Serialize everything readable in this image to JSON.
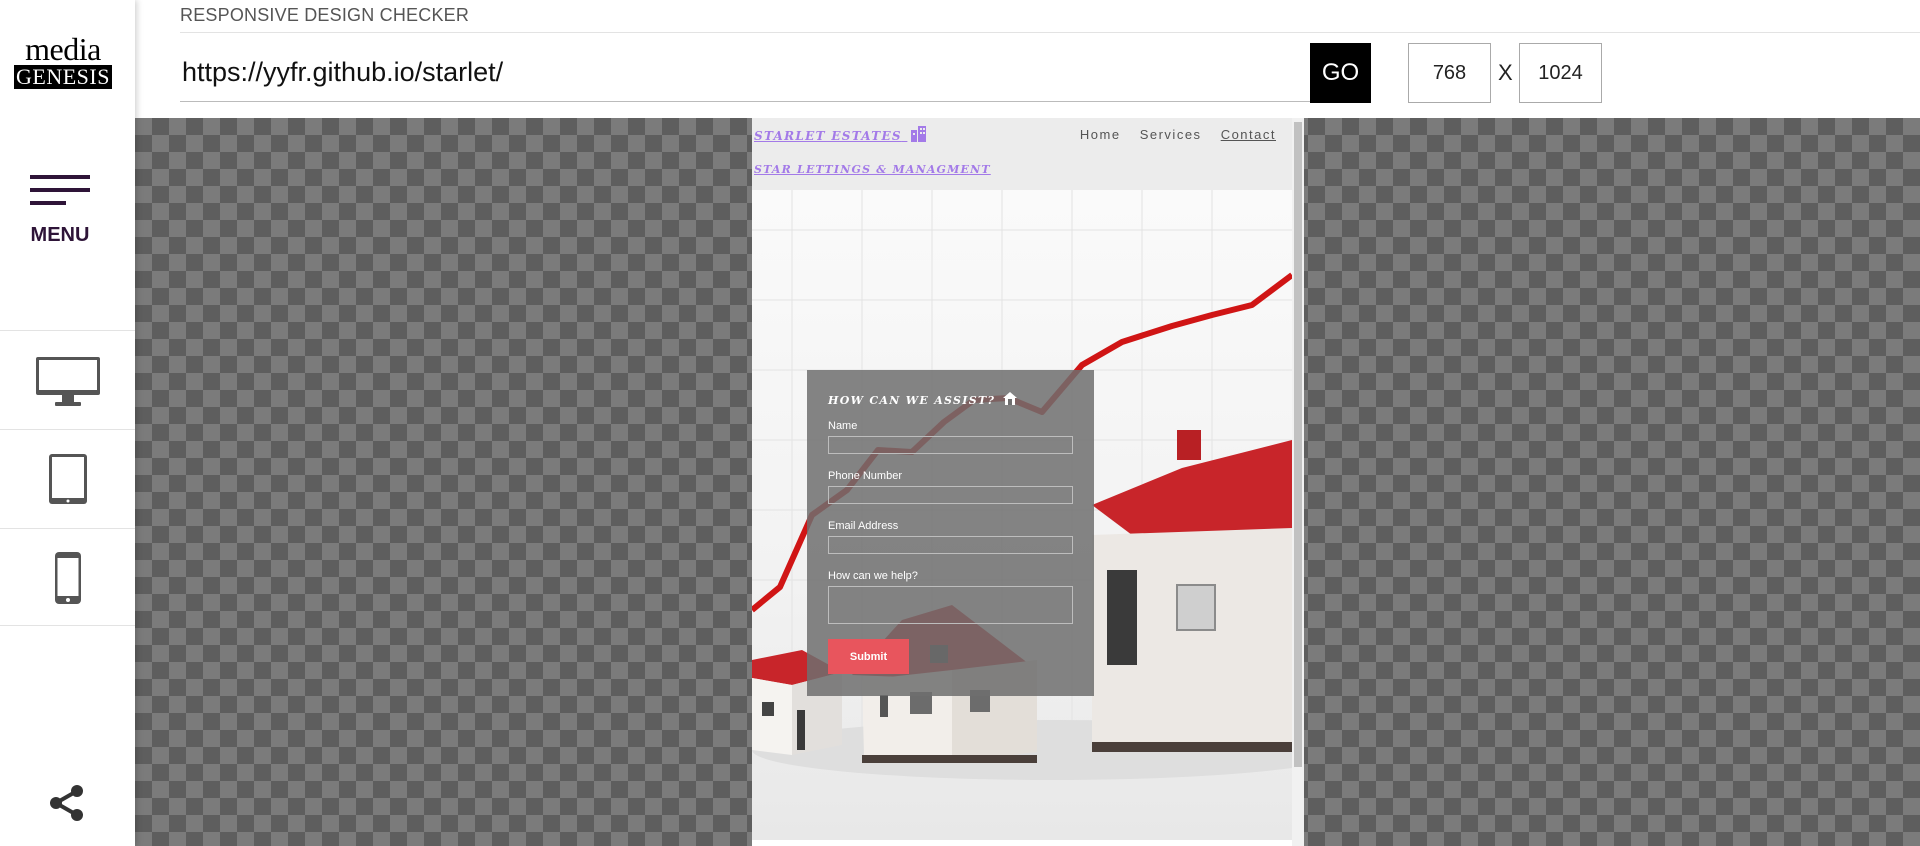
{
  "sidebar": {
    "logo_top": "media",
    "logo_bottom": "GENESIS",
    "menu_label": "MENU",
    "devices": [
      "desktop-icon",
      "tablet-icon",
      "phone-icon"
    ],
    "share_icon": "share-icon"
  },
  "topbar": {
    "title": "RESPONSIVE DESIGN CHECKER",
    "url": "https://yyfr.github.io/starlet/",
    "go_label": "GO",
    "width": "768",
    "separator": "X",
    "height": "1024"
  },
  "site": {
    "brand": "STARLET ESTATES",
    "brand_icon": "building-icon",
    "tagline": "STAR LETTINGS & MANAGMENT",
    "nav": [
      "Home",
      "Services",
      "Contact"
    ],
    "active_nav": "Contact",
    "form": {
      "title": "HOW CAN WE ASSIST?",
      "title_icon": "house-icon",
      "name_label": "Name",
      "phone_label": "Phone Number",
      "email_label": "Email Address",
      "help_label": "How can we help?",
      "submit_label": "Submit"
    }
  },
  "colors": {
    "brand_purple": "#a37ae8",
    "menu_purple": "#2e1438",
    "submit_red": "#e8555d",
    "chart_line_red": "#d01515"
  }
}
